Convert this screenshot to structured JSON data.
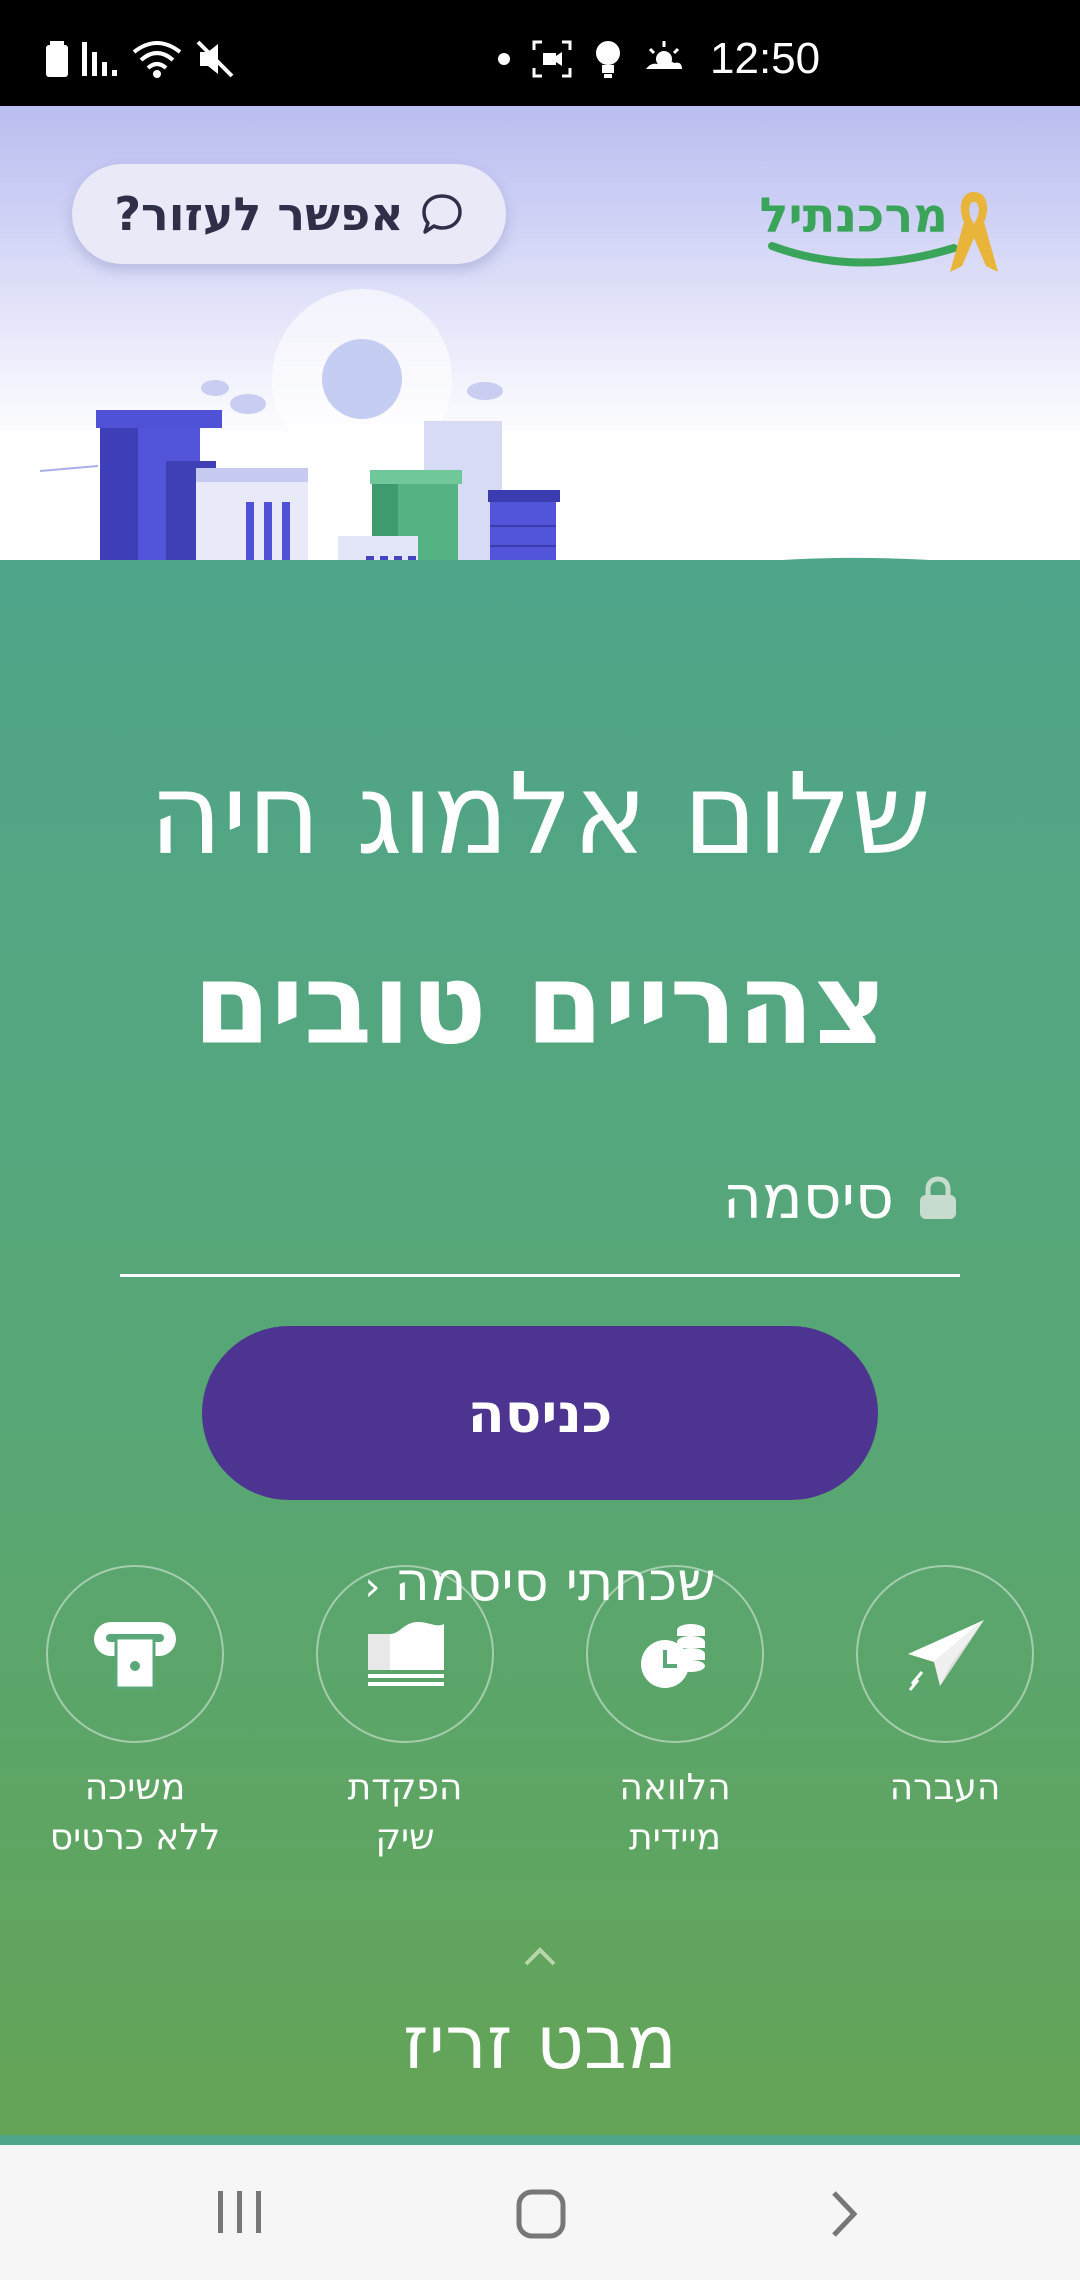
{
  "status_bar": {
    "time": "12:50",
    "icons": [
      "battery-icon",
      "signal-icon",
      "wifi-icon",
      "mute-icon",
      "dot-icon",
      "screen-record-icon",
      "bulb-icon",
      "weather-icon"
    ]
  },
  "header": {
    "help_label": "אפשר לעזור?",
    "logo_text": "מרכנתיל"
  },
  "greeting": {
    "name_line": "שלום אלמוג חיה",
    "time_line": "צהריים טובים"
  },
  "login": {
    "password_label": "סיסמה",
    "submit_label": "כניסה",
    "forgot_label": "שכחתי סיסמה"
  },
  "quick_actions": [
    {
      "label": "העברה",
      "icon": "paper-plane-icon"
    },
    {
      "label": "הלוואה\nמיידית",
      "icon": "coins-clock-icon"
    },
    {
      "label": "הפקדת\nשיק",
      "icon": "check-deposit-icon"
    },
    {
      "label": "משיכה\nללא כרטיס",
      "icon": "atm-withdraw-icon"
    }
  ],
  "quick_view": {
    "label": "מבט זריז"
  },
  "colors": {
    "green": "#4fa58a",
    "purple_button": "#4d3490",
    "brand_green": "#3aa55a",
    "ribbon_gold": "#e8b43a"
  }
}
